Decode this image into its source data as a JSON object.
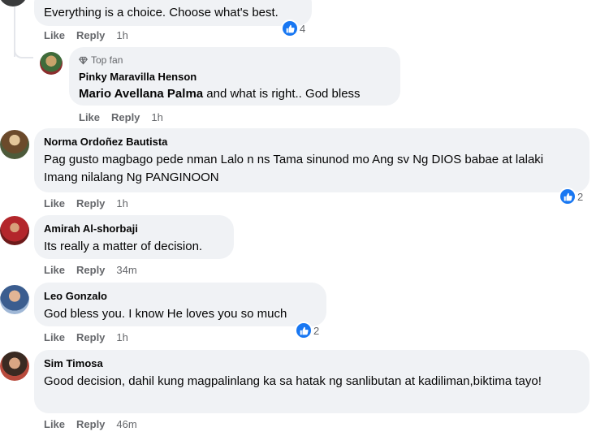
{
  "actions": {
    "like": "Like",
    "reply": "Reply"
  },
  "colors": {
    "accent": "#1877f2",
    "bubble": "#f0f2f5",
    "secondary_text": "#65676b"
  },
  "comments": [
    {
      "text": "Everything is a choice. Choose what's best.",
      "time": "1h",
      "reactions": {
        "icon": "thumbs-up-icon",
        "count": "4"
      }
    },
    {
      "badge": "Top fan",
      "badge_icon": "diamond-icon",
      "author": "Pinky Maravilla Henson",
      "mention": "Mario Avellana Palma",
      "text": " and what is right.. God bless",
      "time": "1h"
    },
    {
      "author": "Norma Ordoñez Bautista",
      "text": "Pag gusto magbago pede nman Lalo n ns Tama sinunod mo Ang sv Ng DIOS babae at lalaki Imang nilalang Ng PANGINOON",
      "time": "1h",
      "reactions": {
        "icon": "thumbs-up-icon",
        "count": "2"
      }
    },
    {
      "author": "Amirah Al-shorbaji",
      "text": "Its really a matter of decision.",
      "time": "34m"
    },
    {
      "author": "Leo Gonzalo",
      "text": "God bless you. I know He loves you so much",
      "time": "1h",
      "reactions": {
        "icon": "thumbs-up-icon",
        "count": "2"
      }
    },
    {
      "author": "Sim Timosa",
      "text": "Good decision, dahil kung magpalinlang ka sa hatak ng sanlibutan at kadiliman,biktima tayo!",
      "time": "46m"
    }
  ]
}
